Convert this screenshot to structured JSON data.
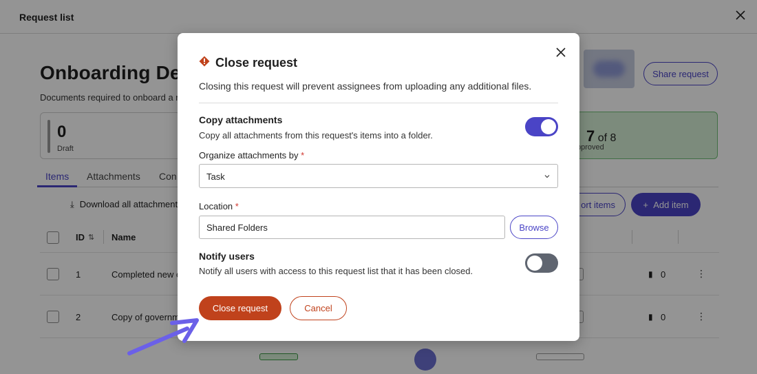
{
  "background": {
    "topbar_title": "Request list",
    "page_heading": "Onboarding Det",
    "page_desc": "Documents required to onboard a ne",
    "draft_count": "0",
    "draft_label": "Draft",
    "approved_count": "7",
    "approved_total": "of 8",
    "approved_label": "pproved",
    "share_label": "Share request",
    "tabs": [
      "Items",
      "Attachments",
      "Con"
    ],
    "download_label": "Download all attachment",
    "export_label": "ort items",
    "add_item_label": "Add item",
    "table_headers": {
      "id": "ID",
      "name": "Name"
    },
    "rows": [
      {
        "id": "1",
        "name": "Completed new c",
        "count": "0"
      },
      {
        "id": "2",
        "name": "Copy of governm",
        "count": "0"
      }
    ]
  },
  "modal": {
    "title": "Close request",
    "subtitle": "Closing this request will prevent assignees from uploading any additional files.",
    "copy_attachments": {
      "title": "Copy attachments",
      "desc": "Copy all attachments from this request's items into a folder.",
      "enabled": true
    },
    "organize_label": "Organize attachments by",
    "organize_value": "Task",
    "location_label": "Location",
    "location_value": "Shared Folders",
    "browse_label": "Browse",
    "notify": {
      "title": "Notify users",
      "desc": "Notify all users with access to this request list that it has been closed.",
      "enabled": false
    },
    "required_marker": "*",
    "close_label": "Close request",
    "cancel_label": "Cancel"
  },
  "colors": {
    "accent": "#4a44c6",
    "danger": "#c0421c",
    "approved_bg": "#d6f0d6",
    "pointer_arrow": "#6b60e8"
  },
  "icons": [
    "close-icon",
    "warning-diamond-icon",
    "chevron-down-icon",
    "download-icon",
    "plus-icon",
    "sort-icon",
    "paperclip-icon",
    "kebab-icon",
    "pointer-arrow"
  ]
}
